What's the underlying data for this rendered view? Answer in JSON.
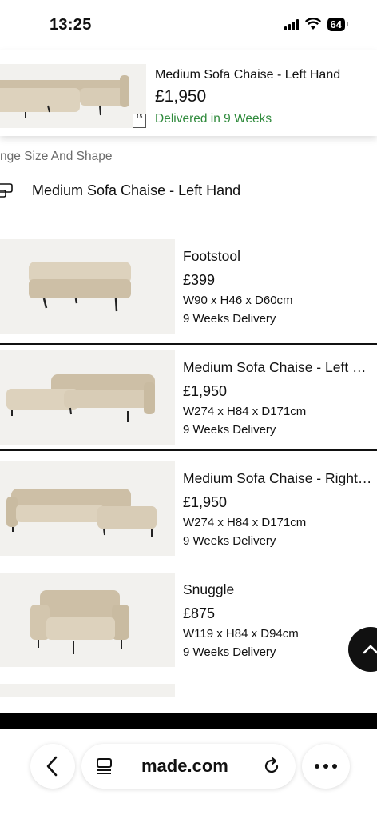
{
  "status": {
    "time": "13:25",
    "battery": "64"
  },
  "sticky": {
    "title": "Medium Sofa Chaise - Left Hand",
    "price": "£1,950",
    "badge": "15",
    "delivery": "Delivered in 9 Weeks",
    "delivery_color": "#2f8a3c"
  },
  "change_size": {
    "label": "nge Size And Shape",
    "selected": "Medium Sofa Chaise - Left Hand"
  },
  "products": [
    {
      "name": "Footstool",
      "price": "£399",
      "dims": "W90 x H46 x D60cm",
      "delivery": "9 Weeks Delivery",
      "image_icon": "footstool-image"
    },
    {
      "name": "Medium Sofa Chaise - Left Hand",
      "price": "£1,950",
      "dims": "W274 x H84 x D171cm",
      "delivery": "9 Weeks Delivery",
      "image_icon": "left-chaise-sofa-image"
    },
    {
      "name": "Medium Sofa Chaise - Right Hand",
      "price": "£1,950",
      "dims": "W274 x H84 x D171cm",
      "delivery": "9 Weeks Delivery",
      "image_icon": "right-chaise-sofa-image"
    },
    {
      "name": "Snuggle",
      "price": "£875",
      "dims": "W119 x H84 x D94cm",
      "delivery": "9 Weeks Delivery",
      "image_icon": "snuggle-chair-image"
    }
  ],
  "browser": {
    "url": "made.com"
  }
}
